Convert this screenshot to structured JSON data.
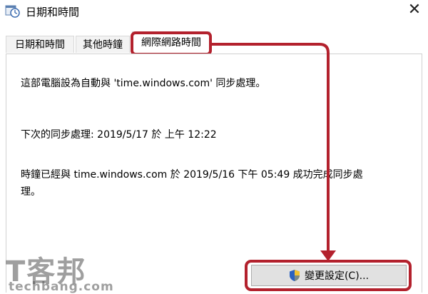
{
  "window": {
    "title": "日期和時間",
    "close_glyph": "✕"
  },
  "tabs": [
    {
      "label": "日期和時間",
      "active": false
    },
    {
      "label": "其他時鐘",
      "active": false
    },
    {
      "label": "網際網路時間",
      "active": true
    }
  ],
  "content": {
    "sync_info": "這部電腦設為自動與 'time.windows.com' 同步處理。",
    "next_sync": "下次的同步處理: 2019/5/17 於 上午 12:22",
    "last_sync_line1": "時鐘已經與 time.windows.com 於 2019/5/16 下午 05:49 成功完成同步處",
    "last_sync_line2": "理。"
  },
  "buttons": {
    "change_settings": "變更設定(C)..."
  },
  "watermark": {
    "brand_cn": "T客邦",
    "brand_en": "techbang.com"
  },
  "colors": {
    "highlight": "#b3212d"
  },
  "icons": {
    "app": "clock-calendar-icon",
    "button": "uac-shield-icon"
  }
}
